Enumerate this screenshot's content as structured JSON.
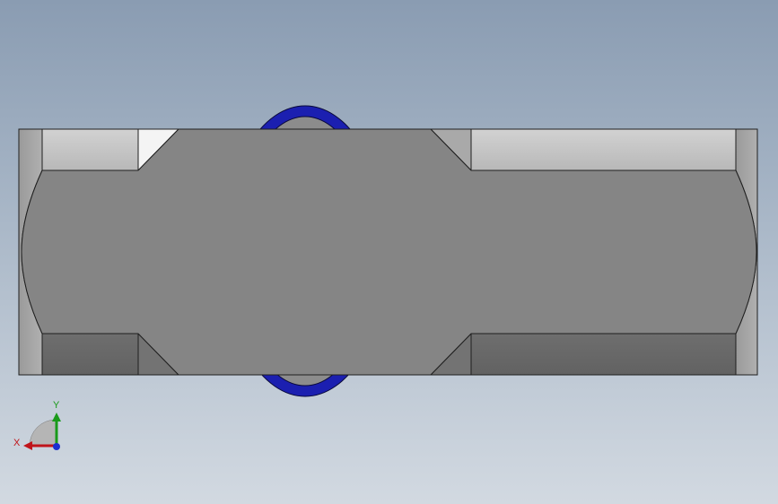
{
  "viewport": {
    "background_top": "#8a9cb2",
    "background_bottom": "#d2d9e1"
  },
  "model": {
    "body_color": "#858585",
    "outline_color": "#1f1f1f",
    "ring_color": "#1b1fb0",
    "face_light": "#c4c4c4",
    "face_dark": "#6a6a6a"
  },
  "triad": {
    "x_label": "X",
    "y_label": "Y",
    "x_color": "#c0141a",
    "y_color": "#1a9a1a",
    "z_color": "#1a2fd0"
  }
}
